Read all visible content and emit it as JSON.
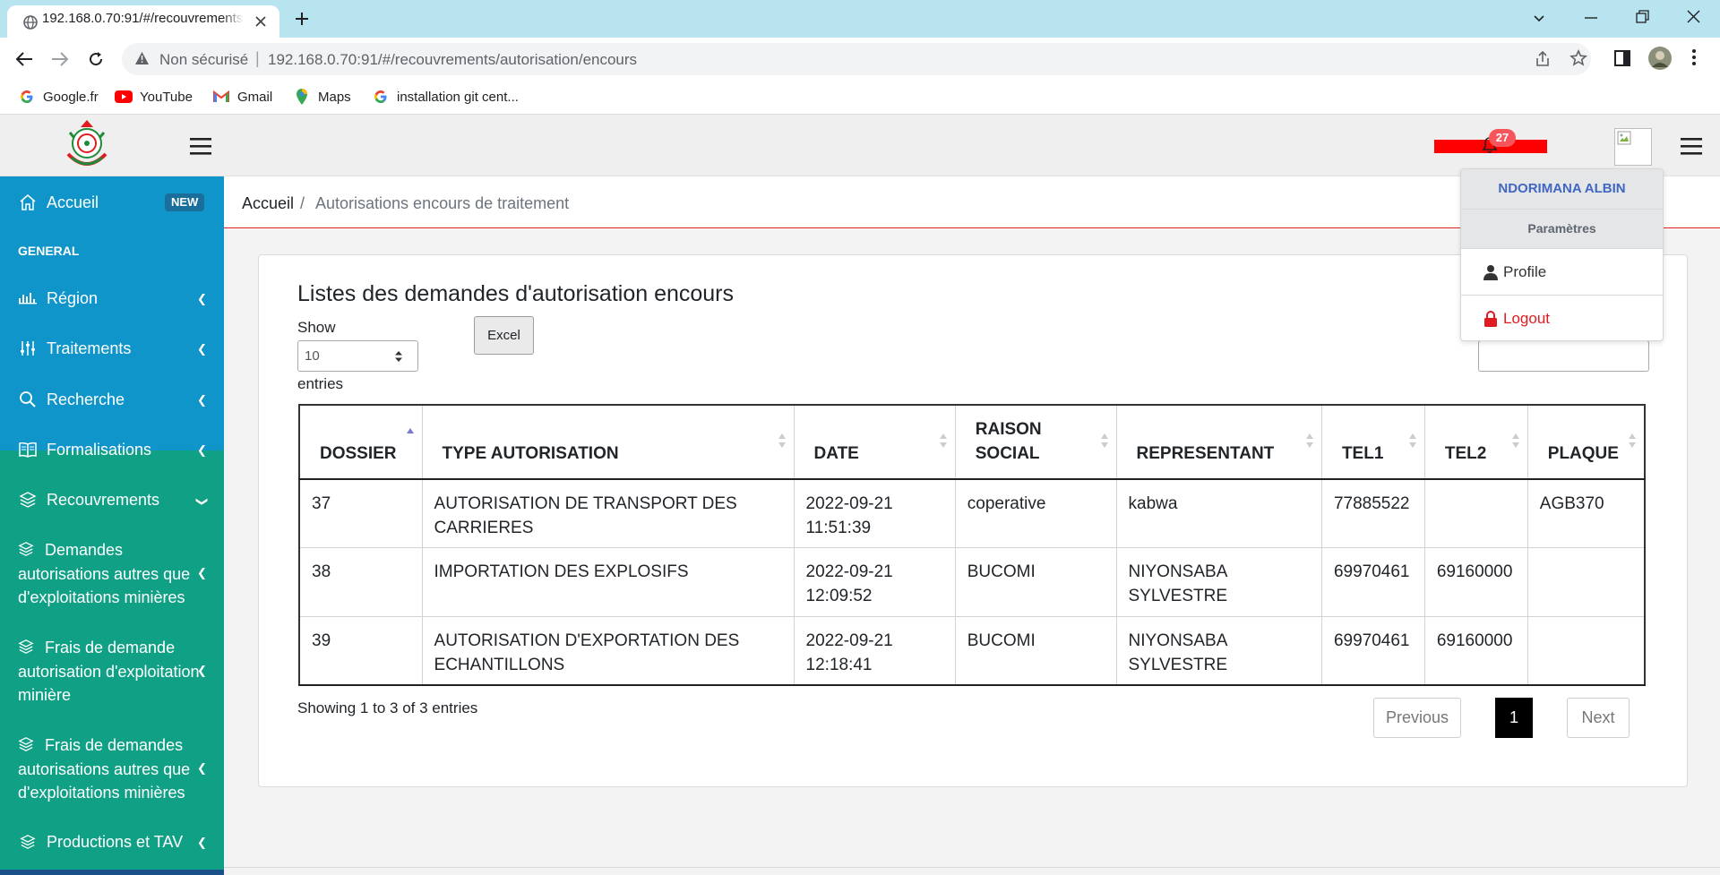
{
  "browser": {
    "tab_title": "192.168.0.70:91/#/recouvrements/autorisation/encours",
    "insecure_label": "Non sécurisé",
    "separator": "|",
    "url": "192.168.0.70:91/#/recouvrements/autorisation/encours",
    "bookmarks": [
      {
        "label": "Google.fr",
        "icon": "google-icon"
      },
      {
        "label": "YouTube",
        "icon": "youtube-icon"
      },
      {
        "label": "Gmail",
        "icon": "gmail-icon"
      },
      {
        "label": "Maps",
        "icon": "maps-icon"
      },
      {
        "label": "installation git cent...",
        "icon": "google-icon"
      }
    ]
  },
  "header": {
    "notification_count": "27"
  },
  "sidebar": {
    "accueil": "Accueil",
    "new_badge": "NEW",
    "section_general": "GENERAL",
    "items": [
      {
        "label": "Région",
        "icon": "chart-icon"
      },
      {
        "label": "Traitements",
        "icon": "sliders-icon"
      },
      {
        "label": "Recherche",
        "icon": "search-icon"
      },
      {
        "label": "Formalisations",
        "icon": "book-icon"
      },
      {
        "label": "Recouvrements",
        "icon": "layers-icon"
      }
    ],
    "sub_items": [
      {
        "label": "Demandes autorisations autres que d'exploitations minières",
        "icon": "layers-icon"
      },
      {
        "label": "Frais de demande autorisation d'exploitation minière",
        "icon": "layers-icon"
      },
      {
        "label": "Frais de demandes autorisations autres que d'exploitations minières",
        "icon": "layers-icon"
      },
      {
        "label": "Productions et TAV",
        "icon": "layers-icon"
      }
    ],
    "colors": {
      "blue": "#0f95c9",
      "green": "#10a085"
    }
  },
  "breadcrumb": {
    "home": "Accueil",
    "separator": "/",
    "current": "Autorisations encours de traitement"
  },
  "main": {
    "title": "Listes des demandes d'autorisation encours",
    "show_label": "Show",
    "entries_value": "10",
    "entries_label": "entries",
    "excel_label": "Excel",
    "columns": [
      "DOSSIER",
      "TYPE AUTORISATION",
      "DATE",
      "RAISON SOCIAL",
      "REPRESENTANT",
      "TEL1",
      "TEL2",
      "PLAQUE"
    ],
    "rows": [
      [
        "37",
        "AUTORISATION DE TRANSPORT DES CARRIERES",
        "2022-09-21 11:51:39",
        "coperative",
        "kabwa",
        "77885522",
        "",
        "AGB370"
      ],
      [
        "38",
        "IMPORTATION DES EXPLOSIFS",
        "2022-09-21 12:09:52",
        "BUCOMI",
        "NIYONSABA SYLVESTRE",
        "69970461",
        "69160000",
        ""
      ],
      [
        "39",
        "AUTORISATION D'EXPORTATION DES ECHANTILLONS",
        "2022-09-21 12:18:41",
        "BUCOMI",
        "NIYONSABA SYLVESTRE",
        "69970461",
        "69160000",
        ""
      ]
    ],
    "info": "Showing 1 to 3 of 3 entries",
    "pagination": {
      "previous": "Previous",
      "page": "1",
      "next": "Next"
    }
  },
  "dropdown": {
    "user_name": "NDORIMANA ALBIN",
    "params": "Paramètres",
    "profile": "Profile",
    "logout": "Logout"
  },
  "colors": {
    "accent_red": "#e11b22",
    "notif_red": "#ff0000"
  }
}
